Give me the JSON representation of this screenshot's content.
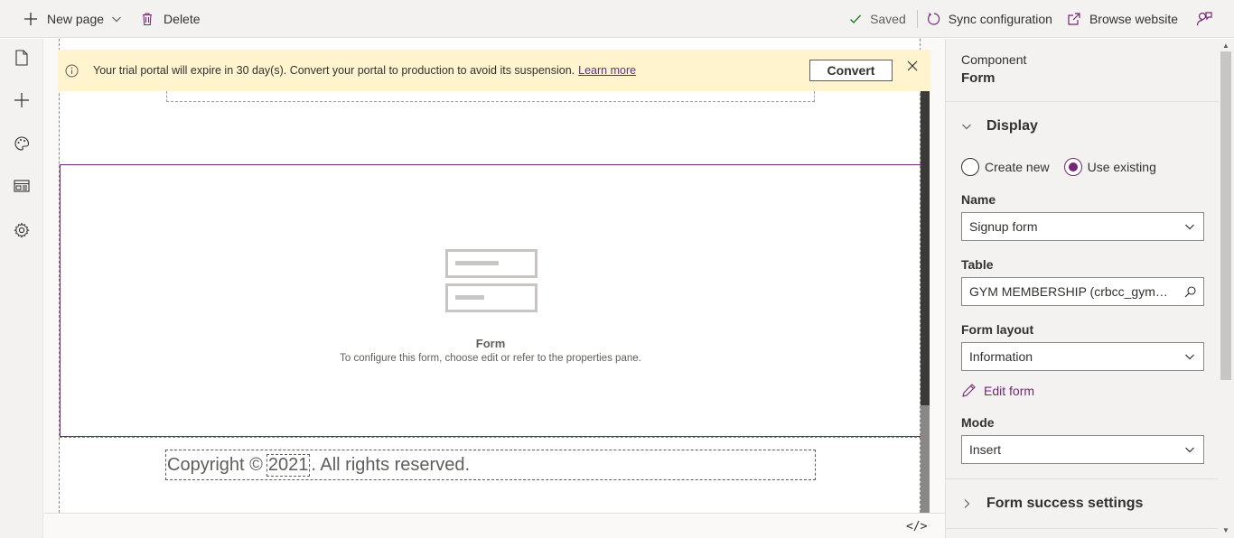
{
  "topbar": {
    "new_page": "New page",
    "delete": "Delete",
    "saved": "Saved",
    "sync": "Sync configuration",
    "browse": "Browse website"
  },
  "rail": {
    "icons": [
      "page-icon",
      "add-icon",
      "theme-icon",
      "templates-icon",
      "settings-icon"
    ]
  },
  "banner": {
    "message": "Your trial portal will expire in 30 day(s). Convert your portal to production to avoid its suspension.",
    "link": "Learn more",
    "convert": "Convert"
  },
  "canvas": {
    "form_title": "Form",
    "form_desc": "To configure this form, choose edit or refer to the properties pane.",
    "copyright_prefix": "Copyright ©",
    "copyright_year": "2021",
    "copyright_suffix": ". All rights reserved.",
    "code_toggle": "</>"
  },
  "panel": {
    "component_label": "Component",
    "component_name": "Form",
    "display_section": "Display",
    "radio_create": "Create new",
    "radio_existing": "Use existing",
    "name_label": "Name",
    "name_value": "Signup form",
    "table_label": "Table",
    "table_value": "GYM MEMBERSHIP (crbcc_gymmembership)",
    "layout_label": "Form layout",
    "layout_value": "Information",
    "edit_form": "Edit form",
    "mode_label": "Mode",
    "mode_value": "Insert",
    "success_section": "Form success settings"
  },
  "colors": {
    "accent": "#742774",
    "banner_bg": "#fff4ce"
  }
}
